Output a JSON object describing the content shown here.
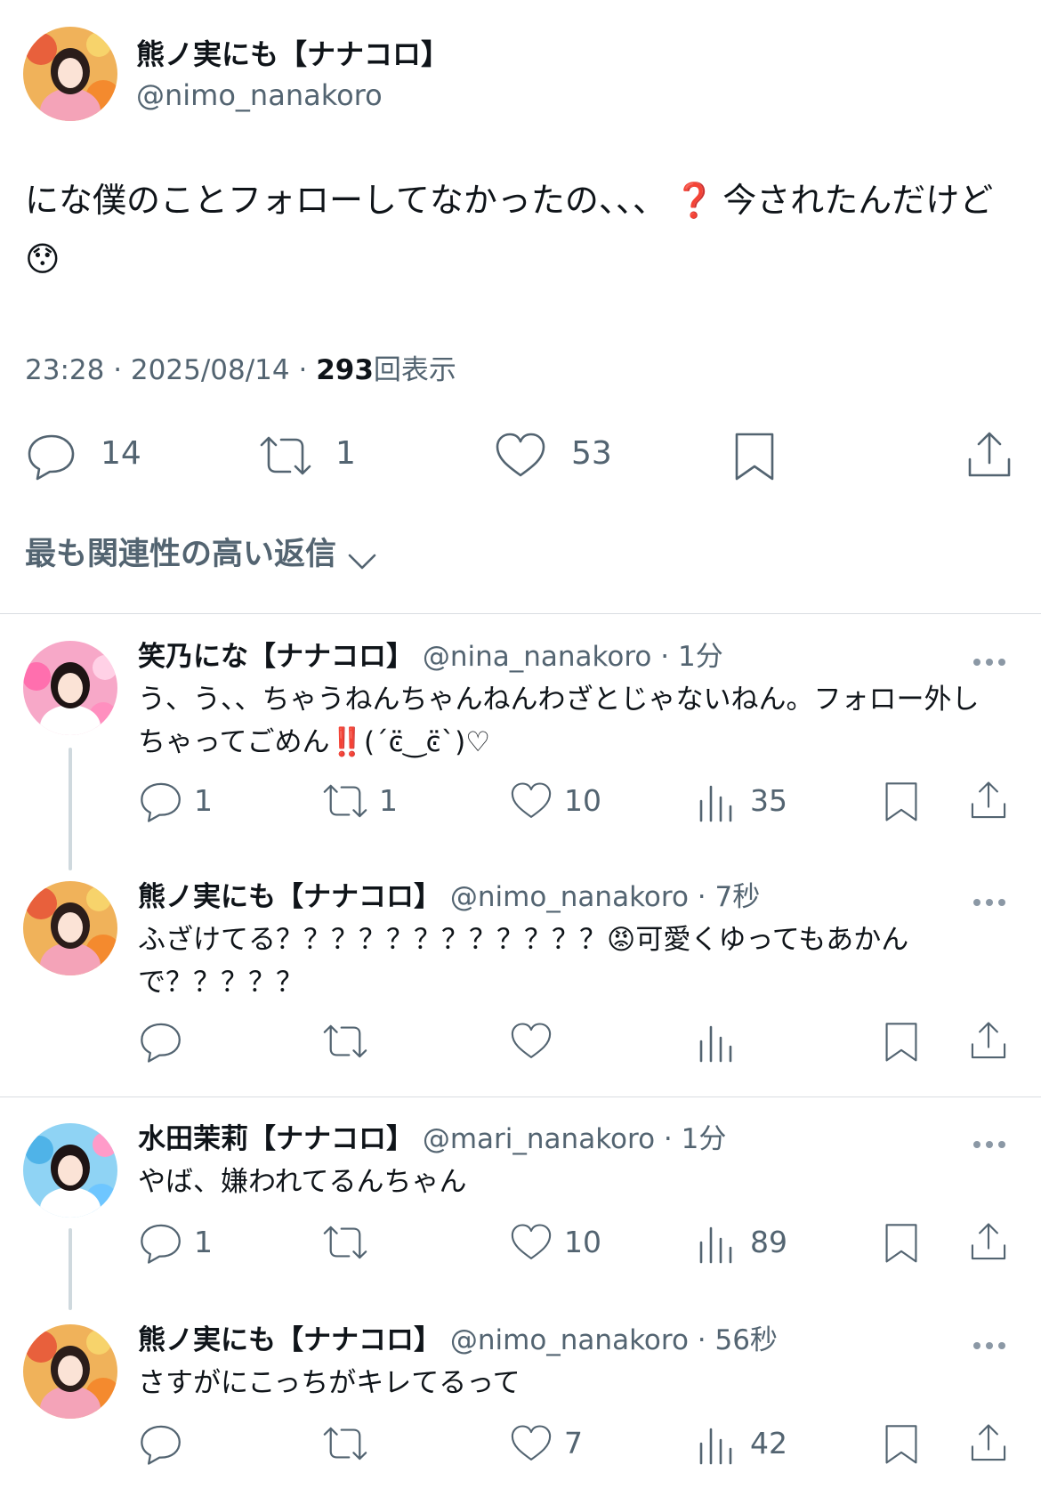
{
  "main_tweet": {
    "author_name": "熊ノ実にも【ナナコロ】",
    "author_handle": "@nimo_nanakoro",
    "text_part1": "にな僕のことフォローしてなかったの、、、",
    "text_emoji1": "❓",
    "text_part2": "今されたんだけど",
    "text_emoji2": "😯",
    "time": "23:28",
    "date": "2025/08/14",
    "views": "293",
    "views_label": "回表示",
    "reply_count": "14",
    "retweet_count": "1",
    "like_count": "53"
  },
  "sort": {
    "label": "最も関連性の高い返信"
  },
  "replies": [
    {
      "name": "笑乃にな【ナナコロ】",
      "handle": "@nina_nanakoro",
      "time": "· 1分",
      "text": "う、う、、ちゃうねんちゃんねんわざとじゃないねん。フォロー外しちゃってごめん‼️(´ͼ̈‿ͼ̈`)♡",
      "reply_count": "1",
      "retweet_count": "1",
      "like_count": "10",
      "view_count": "35"
    },
    {
      "name": "熊ノ実にも【ナナコロ】",
      "handle": "@nimo_nanakoro",
      "time": "· 7秒",
      "text": "ふざけてる？？？？？？？？？？？？😡可愛くゆってもあかんで？？？？？",
      "reply_count": "",
      "retweet_count": "",
      "like_count": "",
      "view_count": ""
    },
    {
      "name": "水田茉莉【ナナコロ】",
      "handle": "@mari_nanakoro",
      "time": "· 1分",
      "text": "やば、嫌われてるんちゃん",
      "reply_count": "1",
      "retweet_count": "",
      "like_count": "10",
      "view_count": "89"
    },
    {
      "name": "熊ノ実にも【ナナコロ】",
      "handle": "@nimo_nanakoro",
      "time": "· 56秒",
      "text": "さすがにこっちがキレてるって",
      "reply_count": "",
      "retweet_count": "",
      "like_count": "7",
      "view_count": "42"
    }
  ],
  "colors": {
    "text": "#0f1419",
    "secondary": "#536471",
    "divider": "#d9dde1",
    "emoji_red": "#e0245e"
  }
}
